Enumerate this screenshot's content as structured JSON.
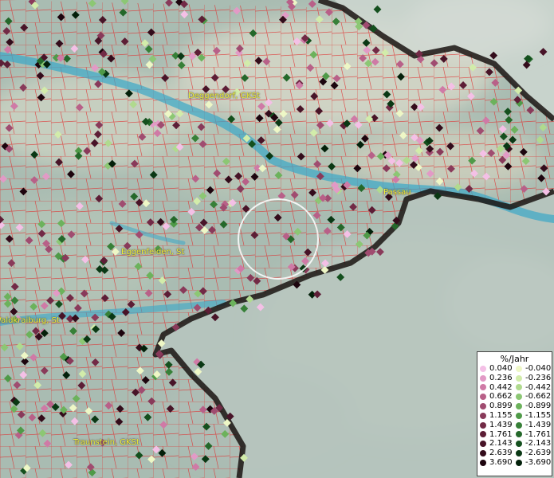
{
  "map": {
    "towns": [
      "Deggendorf, GKSt",
      "Passau",
      "Eggenfelden, St",
      "Waldkraiburg, St",
      "Traunstein, GKSt"
    ]
  },
  "legend": {
    "title": "%/Jahr",
    "positive": [
      {
        "label": "0.040",
        "color": "#f4c0e6"
      },
      {
        "label": "0.236",
        "color": "#e29ac6"
      },
      {
        "label": "0.442",
        "color": "#cf7aa6"
      },
      {
        "label": "0.662",
        "color": "#b86088"
      },
      {
        "label": "0.899",
        "color": "#a04c70"
      },
      {
        "label": "1.155",
        "color": "#893a5a"
      },
      {
        "label": "1.439",
        "color": "#722a46"
      },
      {
        "label": "1.761",
        "color": "#5d1e36"
      },
      {
        "label": "2.143",
        "color": "#481428"
      },
      {
        "label": "2.639",
        "color": "#330c1b"
      },
      {
        "label": "3.690",
        "color": "#1d050e"
      }
    ],
    "negative": [
      {
        "label": "-0.040",
        "color": "#eef7c6"
      },
      {
        "label": "-0.236",
        "color": "#d2ecaa"
      },
      {
        "label": "-0.442",
        "color": "#b0da8e"
      },
      {
        "label": "-0.662",
        "color": "#8cc774"
      },
      {
        "label": "-0.899",
        "color": "#6cb25c"
      },
      {
        "label": "-1.155",
        "color": "#4f9a48"
      },
      {
        "label": "-1.439",
        "color": "#378038"
      },
      {
        "label": "-1.761",
        "color": "#24682a"
      },
      {
        "label": "-2.143",
        "color": "#14501e"
      },
      {
        "label": "-2.639",
        "color": "#0a3814"
      },
      {
        "label": "-3.690",
        "color": "#03200a"
      }
    ]
  },
  "colors": {
    "boundary": "#e02a2a",
    "border": "#1a1412",
    "river": "#3aa8c8",
    "highlight": "#ffffff"
  }
}
